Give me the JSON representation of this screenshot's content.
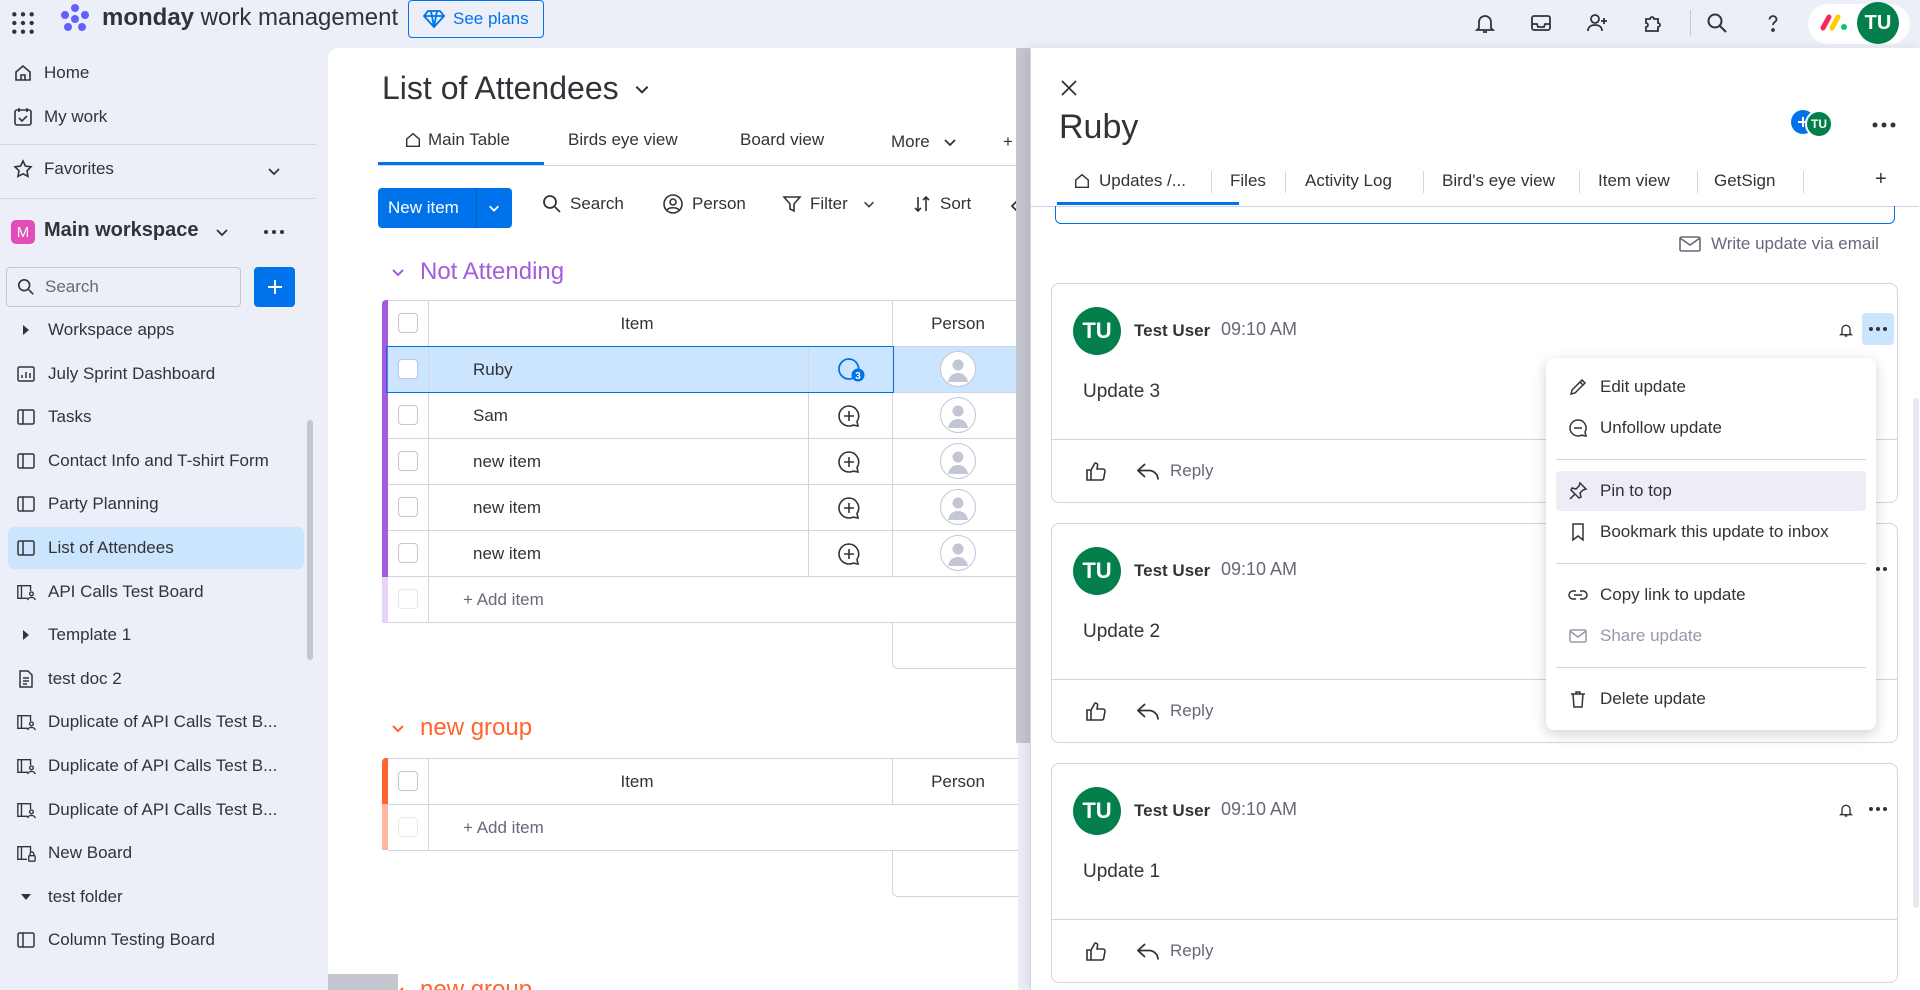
{
  "brand": {
    "name_bold": "monday",
    "name_rest": " work management",
    "see_plans": "See plans",
    "user_initials": "TU"
  },
  "sidebar": {
    "home": "Home",
    "my_work": "My work",
    "favorites": "Favorites",
    "workspace": {
      "badge": "M",
      "name": "Main workspace"
    },
    "search_placeholder": "Search",
    "items": [
      {
        "label": "Workspace apps",
        "type": "folder-collapsed"
      },
      {
        "label": "July Sprint Dashboard",
        "type": "dashboard"
      },
      {
        "label": "Tasks",
        "type": "board"
      },
      {
        "label": "Contact Info and T-shirt Form",
        "type": "board"
      },
      {
        "label": "Party Planning",
        "type": "board"
      },
      {
        "label": "List of Attendees",
        "type": "board",
        "active": true
      },
      {
        "label": "API Calls Test Board",
        "type": "shared-board"
      },
      {
        "label": "Template 1",
        "type": "folder-collapsed"
      },
      {
        "label": "test doc 2",
        "type": "doc"
      },
      {
        "label": "Duplicate of API Calls Test B...",
        "type": "shared-board"
      },
      {
        "label": "Duplicate of API Calls Test B...",
        "type": "shared-board"
      },
      {
        "label": "Duplicate of API Calls Test B...",
        "type": "shared-board"
      },
      {
        "label": "New Board",
        "type": "private-board"
      },
      {
        "label": "test folder",
        "type": "folder-open"
      },
      {
        "label": "Column Testing Board",
        "type": "board"
      }
    ]
  },
  "board": {
    "title": "List of Attendees",
    "tabs": [
      "Main Table",
      "Birds eye view",
      "Board view",
      "More",
      "+"
    ],
    "toolbar": {
      "new_item": "New item",
      "search": "Search",
      "person": "Person",
      "filter": "Filter",
      "sort": "Sort"
    },
    "groups": [
      {
        "title": "Not Attending",
        "color": "#a25ddc",
        "columns": {
          "item": "Item",
          "person": "Person"
        },
        "rows": [
          {
            "name": "Ruby",
            "updates": "3",
            "selected": true
          },
          {
            "name": "Sam"
          },
          {
            "name": "new item"
          },
          {
            "name": "new item"
          },
          {
            "name": "new item"
          }
        ],
        "add_item": "+ Add item"
      },
      {
        "title": "new group",
        "color": "#ff642e",
        "columns": {
          "item": "Item",
          "person": "Person"
        },
        "rows": [],
        "add_item": "+ Add item"
      },
      {
        "title": "new group",
        "color": "#ff642e"
      }
    ]
  },
  "panel": {
    "title": "Ruby",
    "tabs": [
      "Updates /...",
      "Files",
      "Activity Log",
      "Bird's eye view",
      "Item view",
      "GetSign",
      "+"
    ],
    "write_via_email": "Write update via email",
    "updates": [
      {
        "initials": "TU",
        "user": "Test User",
        "time": "09:10 AM",
        "body": "Update 3",
        "reply": "Reply"
      },
      {
        "initials": "TU",
        "user": "Test User",
        "time": "09:10 AM",
        "body": "Update 2",
        "reply": "Reply"
      },
      {
        "initials": "TU",
        "user": "Test User",
        "time": "09:10 AM",
        "body": "Update 1",
        "reply": "Reply"
      }
    ]
  },
  "context_menu": {
    "items": [
      {
        "label": "Edit update",
        "icon": "pencil-icon"
      },
      {
        "label": "Unfollow update",
        "icon": "chat-icon"
      },
      {
        "label": "Pin to top",
        "icon": "pin-icon",
        "highlighted": true
      },
      {
        "label": "Bookmark this update to inbox",
        "icon": "bookmark-icon"
      },
      {
        "label": "Copy link to update",
        "icon": "link-icon"
      },
      {
        "label": "Share update",
        "icon": "mail-icon",
        "disabled": true
      },
      {
        "label": "Delete update",
        "icon": "trash-icon"
      }
    ]
  },
  "colors": {
    "primary": "#0073ea",
    "avatar": "#037f4c",
    "selected": "#cce5ff"
  }
}
